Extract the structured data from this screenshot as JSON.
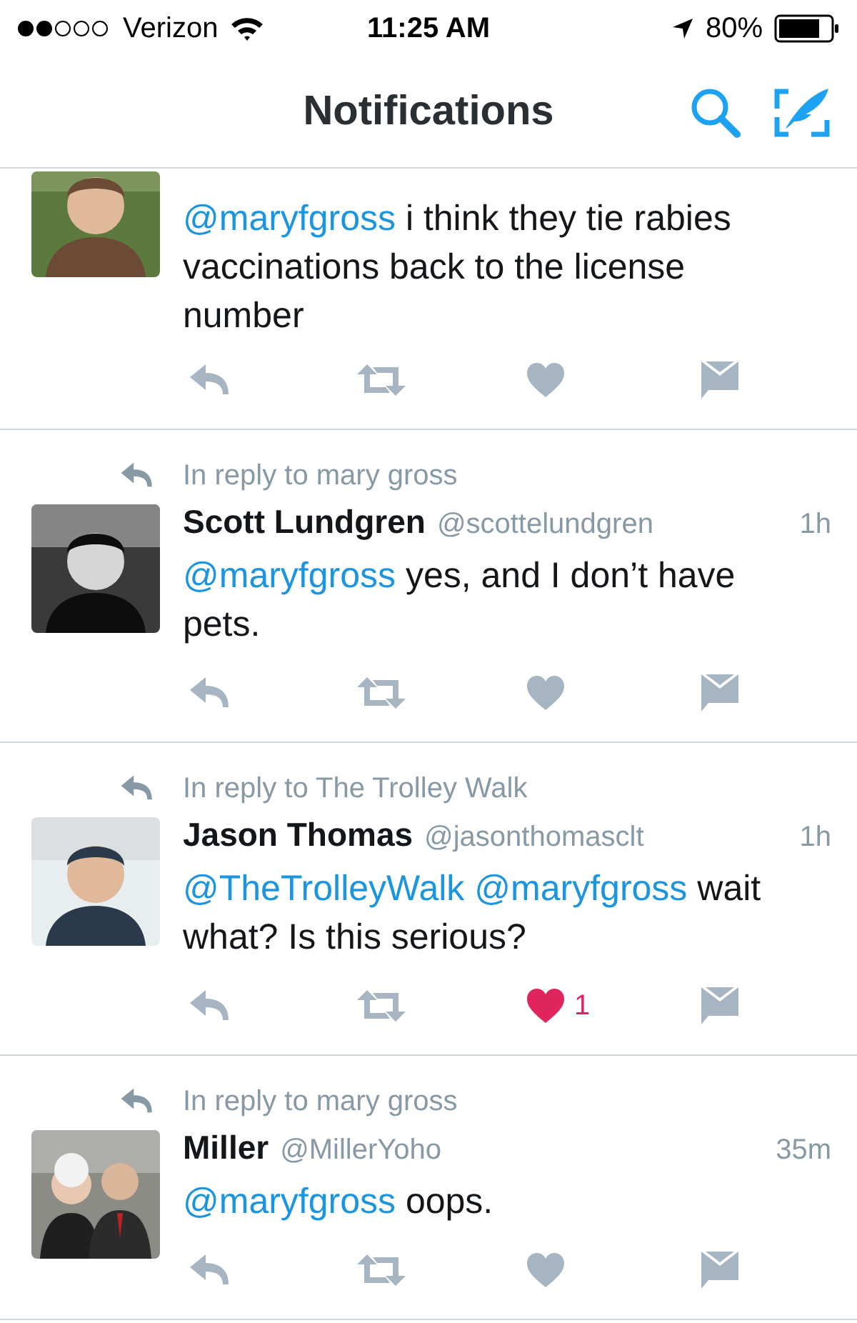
{
  "status_bar": {
    "carrier": "Verizon",
    "time": "11:25 AM",
    "battery": "80%"
  },
  "nav": {
    "title": "Notifications"
  },
  "tweets": [
    {
      "text": [
        {
          "kind": "mention",
          "text": "@maryfgross"
        },
        {
          "kind": "plain",
          "text": " i think they tie rabies vaccinations back to the license number"
        }
      ],
      "liked": false
    },
    {
      "reply_to": "In reply to mary gross",
      "name": "Scott Lundgren",
      "handle": "@scottelundgren",
      "time": "1h",
      "text": [
        {
          "kind": "mention",
          "text": "@maryfgross"
        },
        {
          "kind": "plain",
          "text": " yes, and I don’t have pets."
        }
      ],
      "liked": false
    },
    {
      "reply_to": "In reply to The Trolley Walk",
      "name": "Jason Thomas",
      "handle": "@jasonthomasclt",
      "time": "1h",
      "text": [
        {
          "kind": "mention",
          "text": "@TheTrolleyWalk"
        },
        {
          "kind": "mention",
          "text": "@maryfgross"
        },
        {
          "kind": "plain",
          "text": " wait what? Is this serious?"
        }
      ],
      "liked": true,
      "like_count": "1"
    },
    {
      "reply_to": "In reply to mary gross",
      "name": "Miller",
      "handle": "@MillerYoho",
      "time": "35m",
      "text": [
        {
          "kind": "mention",
          "text": "@maryfgross"
        },
        {
          "kind": "plain",
          "text": " oops."
        }
      ],
      "liked": false
    }
  ]
}
